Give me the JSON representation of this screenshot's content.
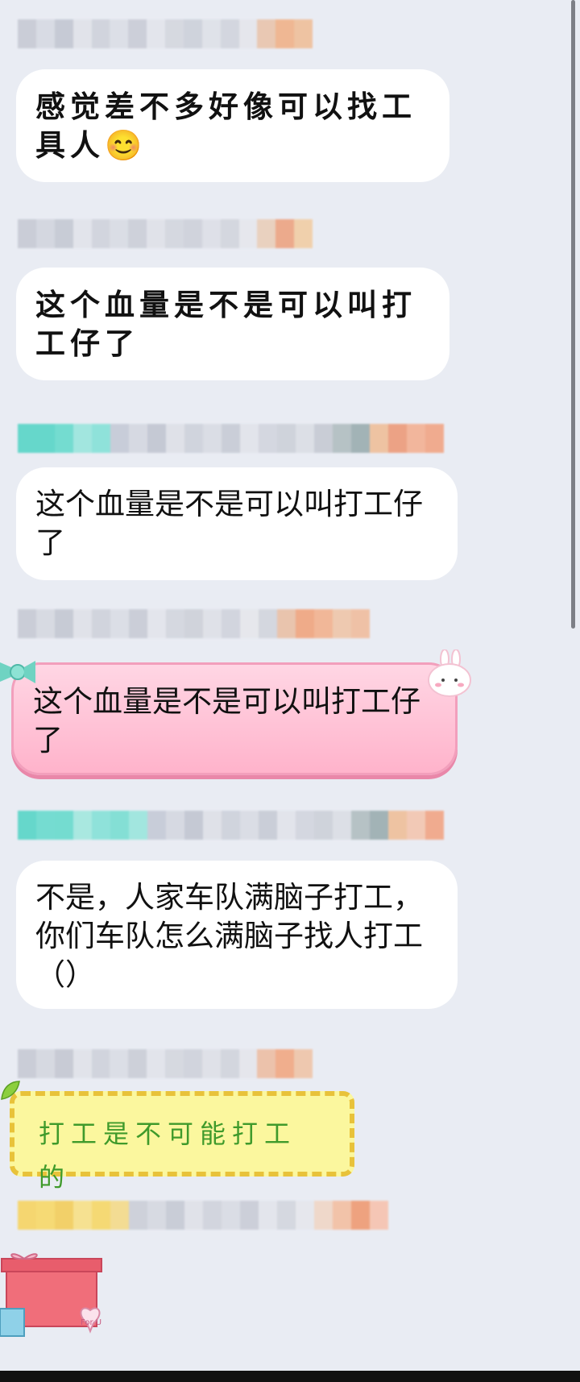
{
  "messages": [
    {
      "text": "感觉差不多好像可以找工具人😊"
    },
    {
      "text": "这个血量是不是可以叫打工仔了"
    },
    {
      "text": "这个血量是不是可以叫打工仔了"
    },
    {
      "text": "这个血量是不是可以叫打工仔了"
    },
    {
      "text": "不是，人家车队满脑子打工，你们车队怎么满脑子找人打工（）"
    },
    {
      "text": "打工是不可能打工的"
    }
  ],
  "decorations": {
    "gift_label": "For U"
  },
  "colors": {
    "background": "#e9ecf3",
    "pink_bubble": "#ffb3cb",
    "yellow_bubble": "#fbf79e",
    "yellow_text": "#3f9a2b"
  }
}
